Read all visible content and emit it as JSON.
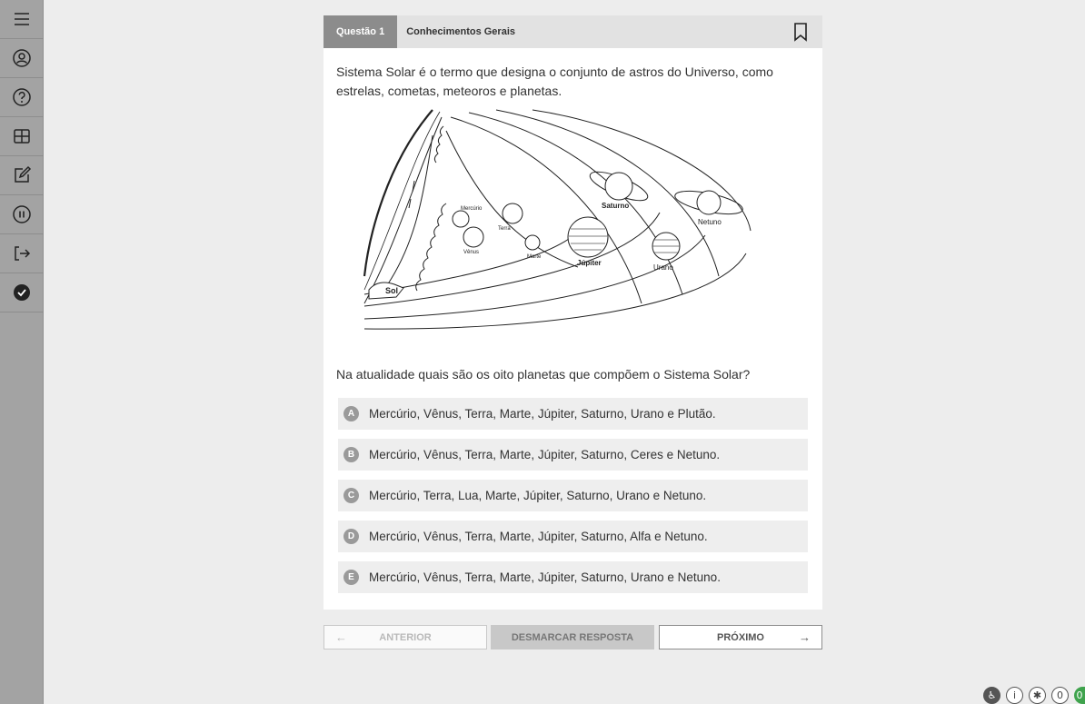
{
  "sidebar": {
    "items": [
      {
        "icon": "menu-icon"
      },
      {
        "icon": "user-icon"
      },
      {
        "icon": "help-icon"
      },
      {
        "icon": "grid-icon"
      },
      {
        "icon": "edit-icon"
      },
      {
        "icon": "pause-icon"
      },
      {
        "icon": "exit-icon"
      },
      {
        "icon": "check-circle-icon"
      }
    ]
  },
  "question": {
    "tab_label": "Questão 1",
    "subject": "Conhecimentos Gerais",
    "statement": "Sistema Solar é o termo que designa o conjunto de astros do Universo, como estrelas, cometas, meteoros e planetas.",
    "figure_labels": {
      "sol": "Sol",
      "mercurio": "Mercúrio",
      "venus": "Vênus",
      "terra": "Terra",
      "marte": "Marte",
      "jupiter": "Júpiter",
      "saturno": "Saturno",
      "urano": "Urano",
      "netuno": "Netuno"
    },
    "prompt": "Na atualidade quais são os oito planetas que compõem o Sistema Solar?",
    "options": [
      {
        "letter": "A",
        "text": "Mercúrio, Vênus, Terra, Marte, Júpiter, Saturno, Urano e Plutão."
      },
      {
        "letter": "B",
        "text": "Mercúrio, Vênus, Terra, Marte, Júpiter, Saturno, Ceres e Netuno."
      },
      {
        "letter": "C",
        "text": "Mercúrio, Terra, Lua, Marte, Júpiter, Saturno, Urano e Netuno."
      },
      {
        "letter": "D",
        "text": "Mercúrio, Vênus, Terra, Marte, Júpiter, Saturno, Alfa e Netuno."
      },
      {
        "letter": "E",
        "text": "Mercúrio, Vênus, Terra, Marte, Júpiter, Saturno, Urano e Netuno."
      }
    ]
  },
  "navigation": {
    "prev_label": "ANTERIOR",
    "clear_label": "DESMARCAR RESPOSTA",
    "next_label": "PRÓXIMO",
    "prev_arrow": "←",
    "next_arrow": "→"
  },
  "tray": {
    "accessibility": "♿",
    "info": "i",
    "bug": "✱",
    "counter": "0",
    "status": "0"
  }
}
